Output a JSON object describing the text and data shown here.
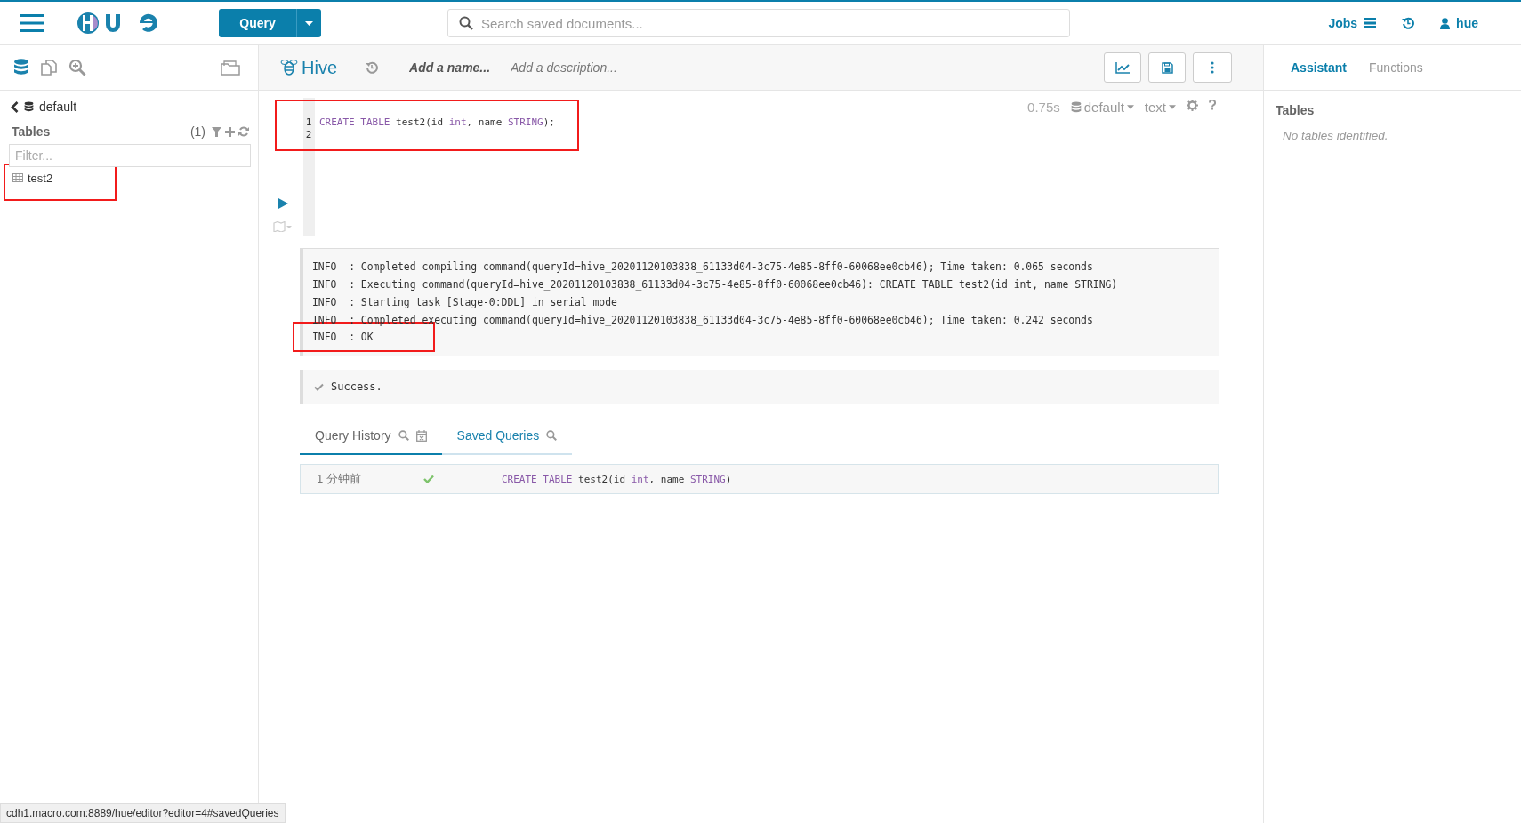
{
  "topbar": {
    "query_button": "Query",
    "search": {
      "placeholder": "Search saved documents..."
    },
    "jobs": "Jobs",
    "user": "hue"
  },
  "sidebar": {
    "database": "default",
    "tables_label": "Tables",
    "count": "(1)",
    "filter": {
      "placeholder": "Filter..."
    },
    "tables": [
      {
        "name": "test2",
        "highlighted": true
      }
    ]
  },
  "editor": {
    "engine": "Hive",
    "name_placeholder": "Add a name...",
    "description_placeholder": "Add a description...",
    "time": "0.75s",
    "database": "default",
    "format": "text",
    "highlighted": true,
    "lines": [
      {
        "number": "1",
        "tokens": [
          {
            "text": "CREATE TABLE",
            "kind": "keyword"
          },
          {
            "text": " test2(id ",
            "kind": "plain"
          },
          {
            "text": "int",
            "kind": "keyword"
          },
          {
            "text": ", name ",
            "kind": "plain"
          },
          {
            "text": "STRING",
            "kind": "keyword"
          },
          {
            "text": ");",
            "kind": "plain"
          }
        ]
      },
      {
        "number": "2"
      }
    ]
  },
  "log": [
    {
      "text": "INFO  : Completed compiling command(queryId=hive_20201120103838_61133d04-3c75-4e85-8ff0-60068ee0cb46); Time taken: 0.065 seconds",
      "highlighted": false
    },
    {
      "text": "INFO  : Executing command(queryId=hive_20201120103838_61133d04-3c75-4e85-8ff0-60068ee0cb46): CREATE TABLE test2(id int, name STRING)",
      "highlighted": false
    },
    {
      "text": "INFO  : Starting task [Stage-0:DDL] in serial mode",
      "highlighted": false
    },
    {
      "text": "INFO  : Completed executing command(queryId=hive_20201120103838_61133d04-3c75-4e85-8ff0-60068ee0cb46); Time taken: 0.242 seconds",
      "highlighted": false
    },
    {
      "text": "INFO  : OK",
      "highlighted": true
    }
  ],
  "result": "Success.",
  "history_tabs": [
    {
      "label": "Query History",
      "selected": true,
      "calendar": true
    },
    {
      "label": "Saved Queries",
      "selected": false,
      "calendar": false
    }
  ],
  "history": [
    {
      "time": "1 分钟前",
      "success": true,
      "tokens": [
        {
          "text": "CREATE TABLE",
          "kind": "keyword"
        },
        {
          "text": " test2(id ",
          "kind": "plain"
        },
        {
          "text": "int",
          "kind": "keyword"
        },
        {
          "text": ", name ",
          "kind": "plain"
        },
        {
          "text": "STRING",
          "kind": "keyword"
        },
        {
          "text": ")",
          "kind": "plain"
        }
      ]
    }
  ],
  "assistant": {
    "tabs": [
      {
        "label": "Assistant",
        "selected": true
      },
      {
        "label": "Functions",
        "selected": false
      }
    ],
    "tables_label": "Tables",
    "empty": "No tables identified."
  },
  "status_url": "cdh1.macro.com:8889/hue/editor?editor=4#savedQueries"
}
